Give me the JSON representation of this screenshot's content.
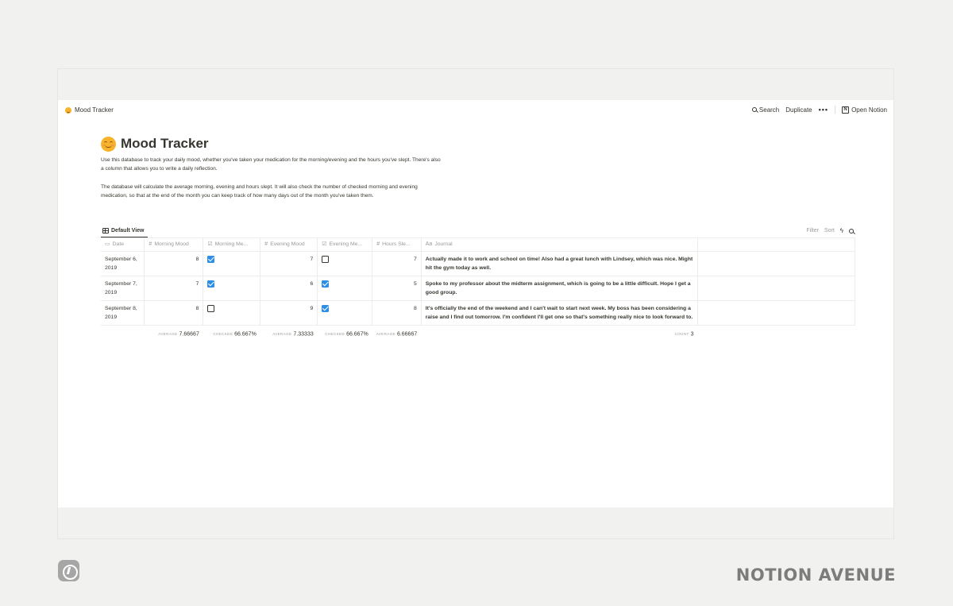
{
  "breadcrumb": {
    "label": "Mood Tracker"
  },
  "topbar": {
    "search": "Search",
    "duplicate": "Duplicate",
    "more": "•••",
    "open_notion": "Open Notion"
  },
  "page": {
    "title": "Mood Tracker",
    "paragraphs": [
      "Use this database to track your daily mood, whether you've taken your medication for the morning/evening and the hours you've slept. There's also a column that allows you to write a daily reflection.",
      "The database will calculate the average morning, evening and hours slept. It will also check the number of checked morning and evening medication, so that at the end of the month you can keep track of how many days out of the month you've taken them."
    ]
  },
  "view": {
    "tab": "Default View",
    "filter": "Filter",
    "sort": "Sort"
  },
  "columns": [
    {
      "icon": "▭",
      "label": "Date"
    },
    {
      "icon": "#",
      "label": "Morning Mood"
    },
    {
      "icon": "☑",
      "label": "Morning Me..."
    },
    {
      "icon": "#",
      "label": "Evening Mood"
    },
    {
      "icon": "☑",
      "label": "Evening Me..."
    },
    {
      "icon": "#",
      "label": "Hours Sle..."
    },
    {
      "icon": "Aa",
      "label": "Journal"
    }
  ],
  "rows": [
    {
      "date": "September 6, 2019",
      "morning_mood": "8",
      "morning_med": true,
      "evening_mood": "7",
      "evening_med": false,
      "hours": "7",
      "journal": "Actually made it to work and school on time! Also had a great lunch with Lindsey, which was nice. Might hit the gym today as well."
    },
    {
      "date": "September 7, 2019",
      "morning_mood": "7",
      "morning_med": true,
      "evening_mood": "6",
      "evening_med": true,
      "hours": "5",
      "journal": "Spoke to my professor about the midterm assignment, which is going to be a little difficult. Hope I get a good group."
    },
    {
      "date": "September 8, 2019",
      "morning_mood": "8",
      "morning_med": false,
      "evening_mood": "9",
      "evening_med": true,
      "hours": "8",
      "journal": "It's officially the end of the weekend and I can't wait to start next week. My boss has been considering a raise and I find out tomorrow. I'm confident I'll get one so that's something really nice to look forward to."
    }
  ],
  "footer": {
    "avg_label": "AVERAGE",
    "checked_label": "CHECKED",
    "count_label": "COUNT",
    "morning_mood": "7.66667",
    "morning_med": "66.667%",
    "evening_mood": "7.33333",
    "evening_med": "66.667%",
    "hours": "6.66667",
    "count": "3"
  },
  "brand": "NOTION AVENUE"
}
